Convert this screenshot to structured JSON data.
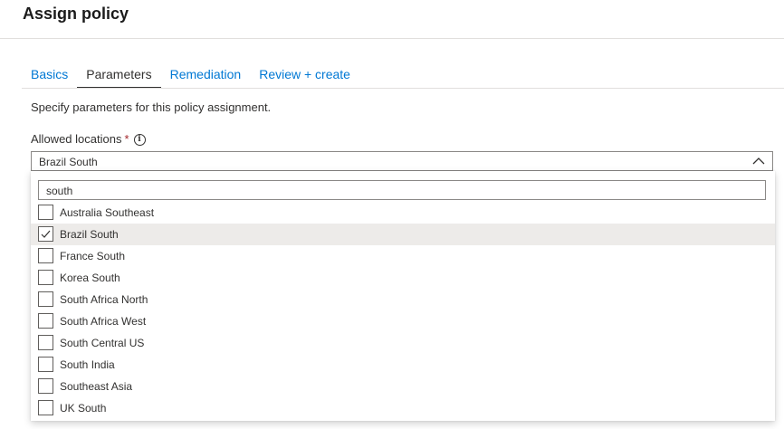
{
  "header": {
    "title": "Assign policy"
  },
  "tabs": [
    {
      "label": "Basics",
      "active": false
    },
    {
      "label": "Parameters",
      "active": true
    },
    {
      "label": "Remediation",
      "active": false
    },
    {
      "label": "Review + create",
      "active": false
    }
  ],
  "description": "Specify parameters for this policy assignment.",
  "field": {
    "label": "Allowed locations",
    "required_marker": "*",
    "info_icon": "info-icon",
    "selected_value": "Brazil South",
    "chevron_icon": "chevron-up-icon"
  },
  "dropdown": {
    "search_value": "south",
    "options": [
      {
        "label": "Australia Southeast",
        "checked": false
      },
      {
        "label": "Brazil South",
        "checked": true
      },
      {
        "label": "France South",
        "checked": false
      },
      {
        "label": "Korea South",
        "checked": false
      },
      {
        "label": "South Africa North",
        "checked": false
      },
      {
        "label": "South Africa West",
        "checked": false
      },
      {
        "label": "South Central US",
        "checked": false
      },
      {
        "label": "South India",
        "checked": false
      },
      {
        "label": "Southeast Asia",
        "checked": false
      },
      {
        "label": "UK South",
        "checked": false
      }
    ]
  },
  "colors": {
    "link": "#0078d4",
    "text": "#323130",
    "required": "#a4262c",
    "selected_bg": "#edebe9"
  }
}
